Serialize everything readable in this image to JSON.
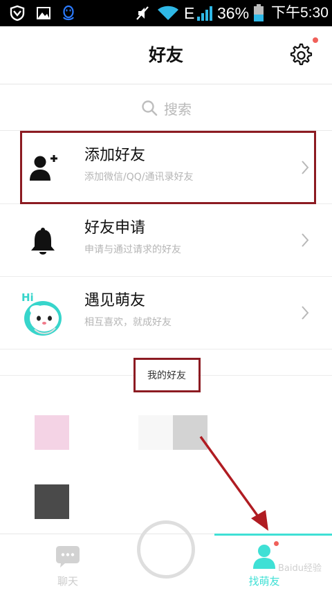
{
  "status_bar": {
    "battery_percent": "36%",
    "network_type": "E",
    "time": "下午5:30",
    "icons": [
      "shield-icon",
      "gallery-icon",
      "qq-penguin-icon",
      "mute-icon",
      "wifi-icon",
      "signal-icon",
      "battery-icon"
    ]
  },
  "header": {
    "title": "好友",
    "settings_icon": "gear-icon",
    "settings_badge": true
  },
  "search": {
    "placeholder": "搜索"
  },
  "rows": [
    {
      "title": "添加好友",
      "subtitle": "添加微信/QQ/通讯录好友",
      "icon": "add-user-icon",
      "highlighted": true
    },
    {
      "title": "好友申请",
      "subtitle": "申请与通过请求的好友",
      "icon": "bell-icon",
      "highlighted": false
    },
    {
      "title": "遇见萌友",
      "subtitle": "相互喜欢，就成好友",
      "icon": "cute-ghost-avatar-icon",
      "highlighted": false
    }
  ],
  "friends_section": {
    "label": "我的好友",
    "highlighted": true
  },
  "friend_thumbnails": [
    {
      "color": "#f4d3e5"
    },
    {
      "color": "#f7f7f7"
    },
    {
      "color": "#d3d3d3"
    },
    {
      "color": "#4a4a4a"
    }
  ],
  "tabbar": {
    "tabs": [
      {
        "label": "聊天",
        "icon": "chat-bubble-icon",
        "active": false
      },
      {
        "label": "找萌友",
        "icon": "person-icon",
        "active": true
      }
    ],
    "accent": "#3fe0d5",
    "inactive_color": "#cccccc"
  },
  "annotation": {
    "box_color": "#8c1b22",
    "arrow_color": "#b01c22"
  },
  "watermark_text": "Baidu经验"
}
